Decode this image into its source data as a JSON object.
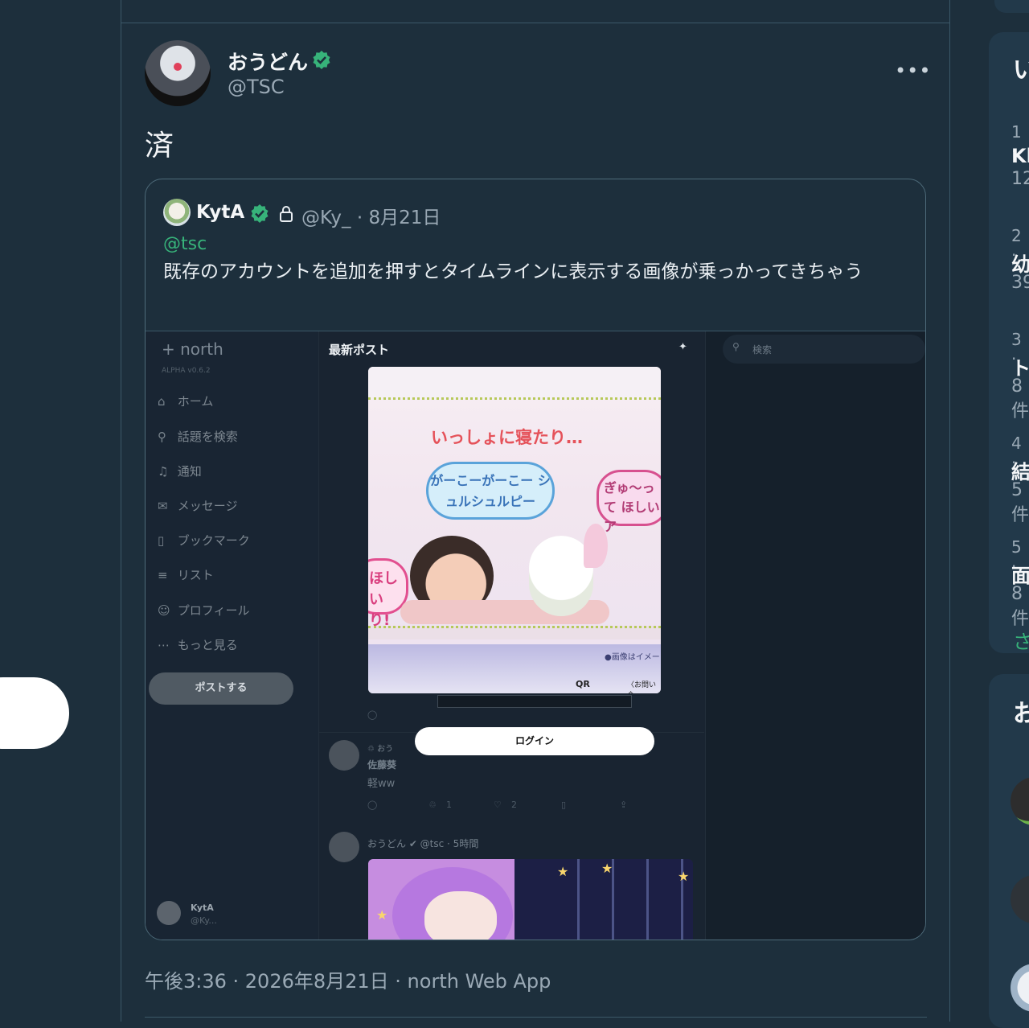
{
  "post": {
    "display_name": "おうどん",
    "handle": "@TSC",
    "text": "済",
    "timestamp": "午後3:36 · 2026年8月21日 · north Web App"
  },
  "quote": {
    "name": "KytA",
    "handle_date": "@Ky_ · 8月21日",
    "mention": "@tsc",
    "text": "既存のアカウントを追加を押すとタイムラインに表示する画像が乗っかってきちゃう"
  },
  "screenshot": {
    "logo": "+ north",
    "alpha": "ALPHA  v0.6.2",
    "nav": [
      {
        "icon": "⌂",
        "label": "ホーム"
      },
      {
        "icon": "⚲",
        "label": "話題を検索"
      },
      {
        "icon": "♫",
        "label": "通知"
      },
      {
        "icon": "✉",
        "label": "メッセージ"
      },
      {
        "icon": "▯",
        "label": "ブックマーク"
      },
      {
        "icon": "≡",
        "label": "リスト"
      },
      {
        "icon": "☺",
        "label": "プロフィール"
      },
      {
        "icon": "⋯",
        "label": "もっと見る"
      }
    ],
    "post_button": "ポストする",
    "user_name": "KytA",
    "user_handle": "@Ky...",
    "feed_title": "最新ポスト",
    "sparkle": "✦",
    "search_placeholder": "検索",
    "photo": {
      "headline": "いっしょに寝たり…",
      "bubble1": "がーこーがーこー シュルシュルピー",
      "bubble2": "ぎゅ〜って ほしいア",
      "bubble3": "ほしい り!",
      "note": "●画像はイメー",
      "qr": "QR",
      "tag": "〈お問い合"
    },
    "login_button": "ログイン",
    "row1": {
      "repost": "♲ おう",
      "name": "佐藤葵",
      "text": "軽ww",
      "retweets": "1",
      "likes": "2"
    },
    "row2": {
      "name": "おうどん ✔ @tsc · 5時間"
    }
  },
  "trends": {
    "heading": "い",
    "items": [
      {
        "rank": "1 ·",
        "word": "Kl",
        "count": "12"
      },
      {
        "rank": "2 ·",
        "word": "幼",
        "count": "39"
      },
      {
        "rank": "3 ·",
        "word": "ト",
        "count": "8件"
      },
      {
        "rank": "4 ·",
        "word": "結",
        "count": "5件"
      },
      {
        "rank": "5 ·",
        "word": "面",
        "count": "8件"
      }
    ],
    "more": "さ"
  },
  "follow": {
    "heading": "お"
  }
}
